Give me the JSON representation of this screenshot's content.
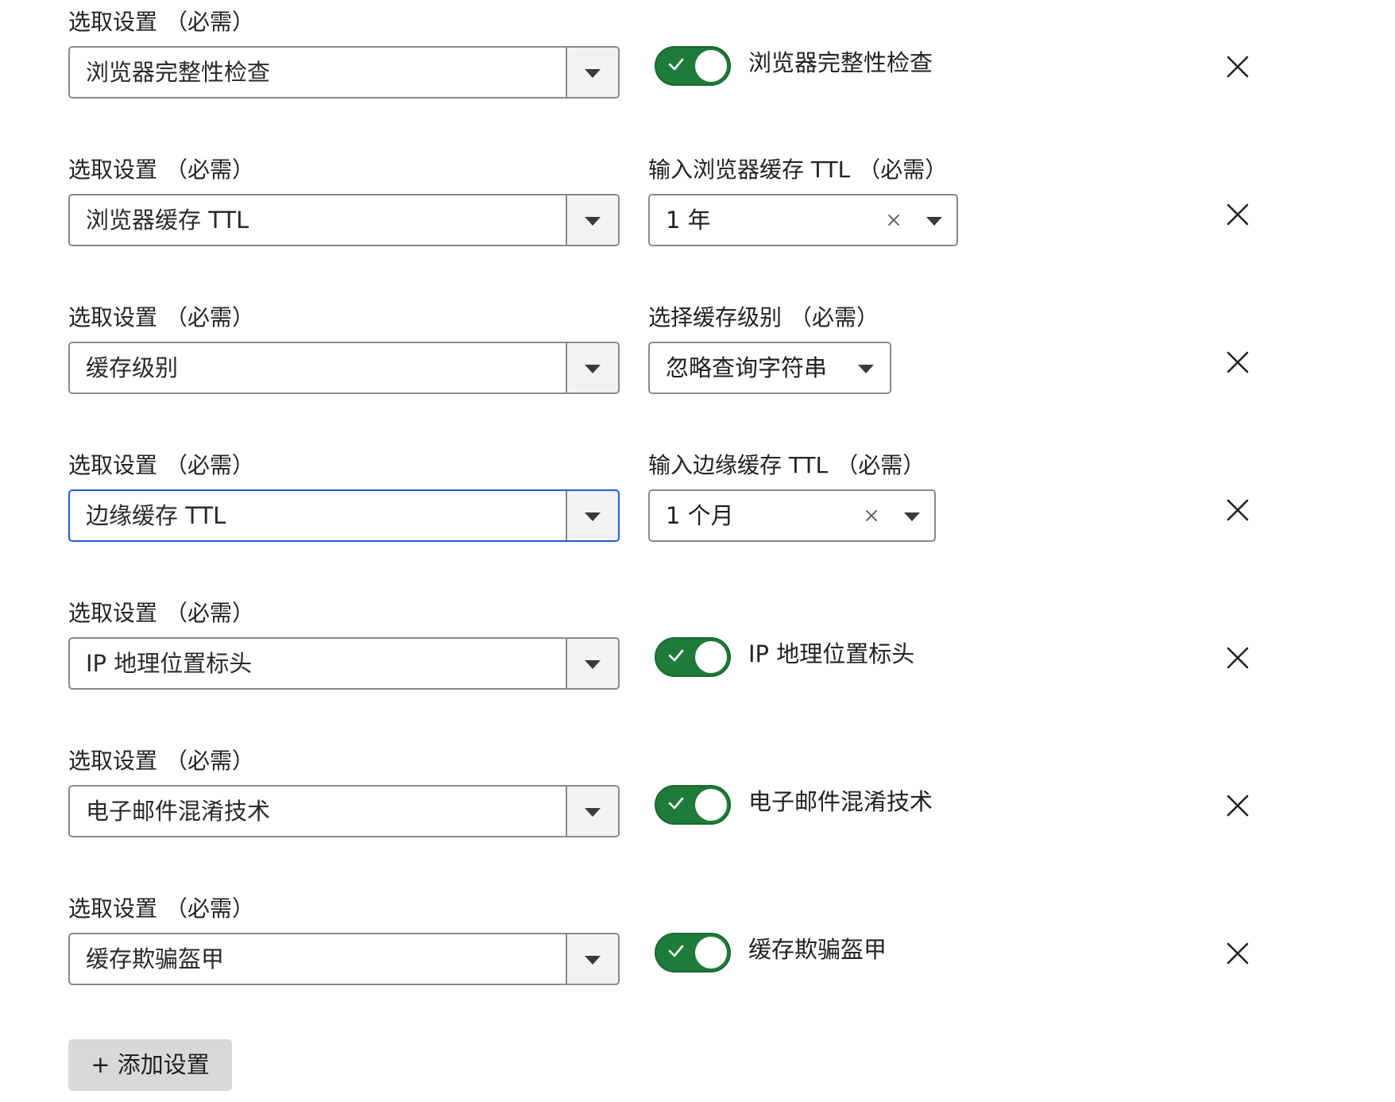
{
  "rows": [
    {
      "label": "选取设置",
      "required": "（必需）",
      "value": "浏览器完整性检查",
      "toggle_label": "浏览器完整性检查",
      "toggle_on": true
    },
    {
      "label": "选取设置",
      "required": "（必需）",
      "value": "浏览器缓存 TTL",
      "sub_label": "输入浏览器缓存 TTL",
      "sub_required": "（必需）",
      "sub_value": "1 年"
    },
    {
      "label": "选取设置",
      "required": "（必需）",
      "value": "缓存级别",
      "sub_label": "选择缓存级别",
      "sub_required": "（必需）",
      "sub_value": "忽略查询字符串"
    },
    {
      "label": "选取设置",
      "required": "（必需）",
      "value": "边缘缓存 TTL",
      "focused": true,
      "sub_label": "输入边缘缓存 TTL",
      "sub_required": "（必需）",
      "sub_value": "1 个月"
    },
    {
      "label": "选取设置",
      "required": "（必需）",
      "value": "IP 地理位置标头",
      "toggle_label": "IP 地理位置标头",
      "toggle_on": true
    },
    {
      "label": "选取设置",
      "required": "（必需）",
      "value": "电子邮件混淆技术",
      "toggle_label": "电子邮件混淆技术",
      "toggle_on": true
    },
    {
      "label": "选取设置",
      "required": "（必需）",
      "value": "缓存欺骗盔甲",
      "toggle_label": "缓存欺骗盔甲",
      "toggle_on": true
    }
  ],
  "add_button": "+ 添加设置",
  "colors": {
    "toggle_on": "#1e7b3a",
    "focus_border": "#1d5fd6",
    "border": "#8a8a8a",
    "button_bg": "#d9d9d9"
  },
  "icons": {
    "dropdown": "chevron-down-icon",
    "remove": "close-icon",
    "clear": "clear-icon",
    "check": "check-icon"
  }
}
